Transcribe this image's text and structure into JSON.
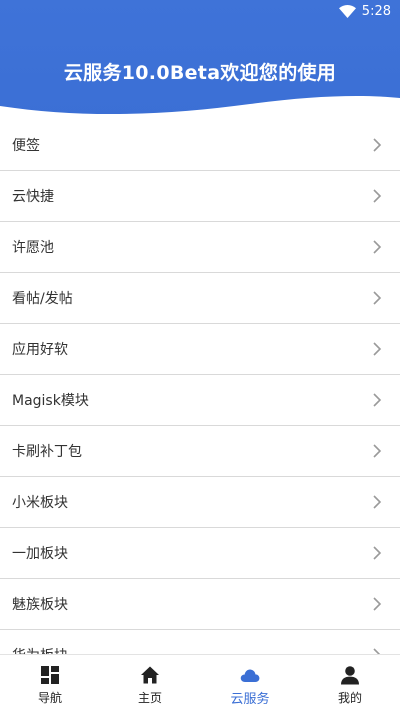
{
  "status": {
    "time": "5:28",
    "wifi_icon": "wifi-icon"
  },
  "header": {
    "title": "云服务10.0Beta欢迎您的使用"
  },
  "list": [
    {
      "label": "便签"
    },
    {
      "label": "云快捷"
    },
    {
      "label": "许愿池"
    },
    {
      "label": "看帖/发帖"
    },
    {
      "label": "应用好软"
    },
    {
      "label": "Magisk模块"
    },
    {
      "label": "卡刷补丁包"
    },
    {
      "label": "小米板块"
    },
    {
      "label": "一加板块"
    },
    {
      "label": "魅族板块"
    },
    {
      "label": "华为板块"
    }
  ],
  "bottom_nav": [
    {
      "label": "导航",
      "icon": "dashboard-icon",
      "active": false
    },
    {
      "label": "主页",
      "icon": "home-icon",
      "active": false
    },
    {
      "label": "云服务",
      "icon": "cloud-icon",
      "active": true
    },
    {
      "label": "我的",
      "icon": "person-icon",
      "active": false
    }
  ],
  "colors": {
    "accent": "#3b6fd5",
    "text": "#333333",
    "divider": "#d9d9d9"
  }
}
